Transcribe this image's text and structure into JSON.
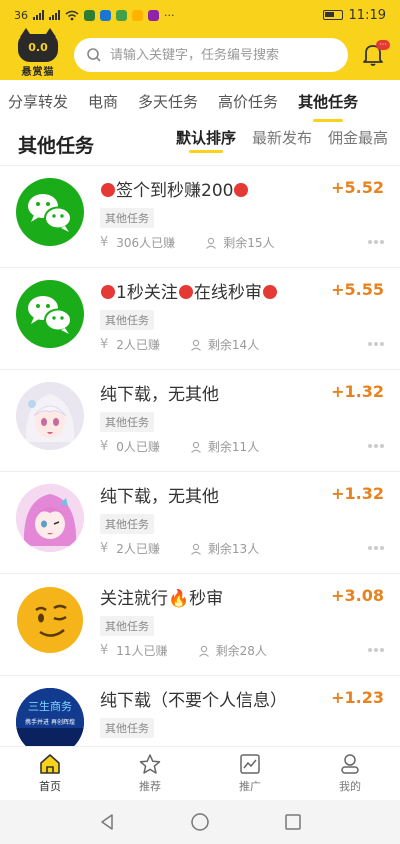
{
  "status": {
    "carrier": "36",
    "time": "11:19"
  },
  "header": {
    "logo_face": "0.0",
    "logo_name": "悬赏猫",
    "search_placeholder": "请输入关键字，任务编号搜索",
    "bell_badge": "···"
  },
  "tabs": [
    "分享转发",
    "电商",
    "多天任务",
    "高价任务",
    "其他任务"
  ],
  "active_tab": "其他任务",
  "section_title": "其他任务",
  "sorts": [
    "默认排序",
    "最新发布",
    "佣金最高"
  ],
  "items": [
    {
      "title_parts": [
        "",
        "签个到秒赚200",
        ""
      ],
      "reward": "+5.52",
      "tag": "其他任务",
      "earned": "306人已赚",
      "remaining": "剩余15人"
    },
    {
      "title_parts": [
        "",
        "1秒关注",
        "在线秒审",
        ""
      ],
      "reward": "+5.55",
      "tag": "其他任务",
      "earned": "2人已赚",
      "remaining": "剩余14人"
    },
    {
      "title": "纯下载，无其他",
      "reward": "+1.32",
      "tag": "其他任务",
      "earned": "0人已赚",
      "remaining": "剩余11人"
    },
    {
      "title": "纯下载，无其他",
      "reward": "+1.32",
      "tag": "其他任务",
      "earned": "2人已赚",
      "remaining": "剩余13人"
    },
    {
      "title": "关注就行🔥秒审",
      "reward": "+3.08",
      "tag": "其他任务",
      "earned": "11人已赚",
      "remaining": "剩余28人"
    },
    {
      "title": "纯下载（不要个人信息）",
      "reward": "+1.23",
      "tag": "其他任务",
      "earned": "",
      "remaining": ""
    }
  ],
  "avatar6_text": [
    "三生商务",
    "携手并进 再创辉煌"
  ],
  "bottom_nav": [
    {
      "label": "首页",
      "icon": "home-icon"
    },
    {
      "label": "推荐",
      "icon": "star-icon"
    },
    {
      "label": "推广",
      "icon": "chart-icon"
    },
    {
      "label": "我的",
      "icon": "user-icon"
    }
  ],
  "colors": {
    "brand_yellow": "#f9d21c",
    "reward_orange": "#e8821e",
    "badge_red": "#e53935"
  }
}
